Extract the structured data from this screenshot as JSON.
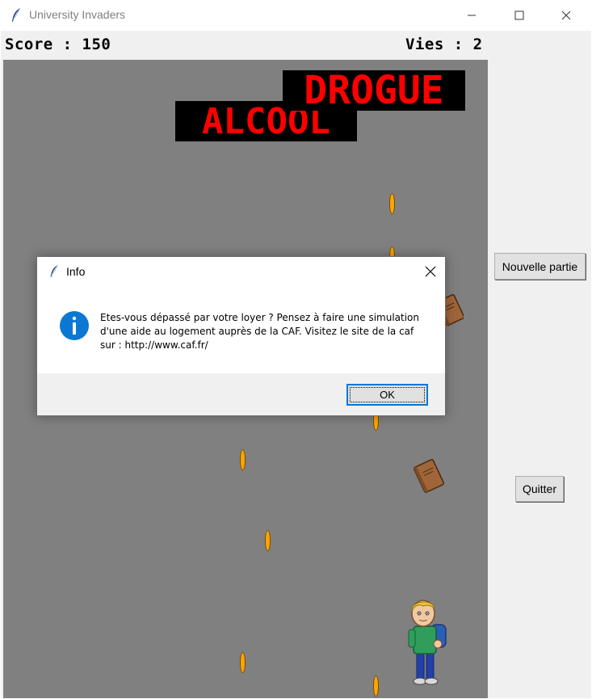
{
  "window": {
    "title": "University Invaders",
    "icons": {
      "app": "feather-icon",
      "minimize": "minimize-icon",
      "maximize": "maximize-icon",
      "close": "close-icon"
    }
  },
  "hud": {
    "score": "Score : 150",
    "lives": "Vies : 2"
  },
  "game": {
    "enemies": [
      {
        "label": "ALCOOL",
        "text_color": "#ff0000",
        "bg_color": "#000000"
      },
      {
        "label": "DROGUE",
        "text_color": "#ff0000",
        "bg_color": "#000000"
      }
    ],
    "projectile_color": "#ffa500",
    "canvas_color": "#808080",
    "sprites": [
      "book-icon",
      "book-icon",
      "student-icon"
    ]
  },
  "side_buttons": {
    "new_game": "Nouvelle partie",
    "quit": "Quitter"
  },
  "dialog": {
    "title": "Info",
    "icon": "info-icon",
    "message": "Etes-vous dépassé par votre loyer ? Pensez à faire une simulation d'une aide au logement auprès de la CAF. Visitez le site de la caf sur : http://www.caf.fr/",
    "ok_label": "OK"
  }
}
